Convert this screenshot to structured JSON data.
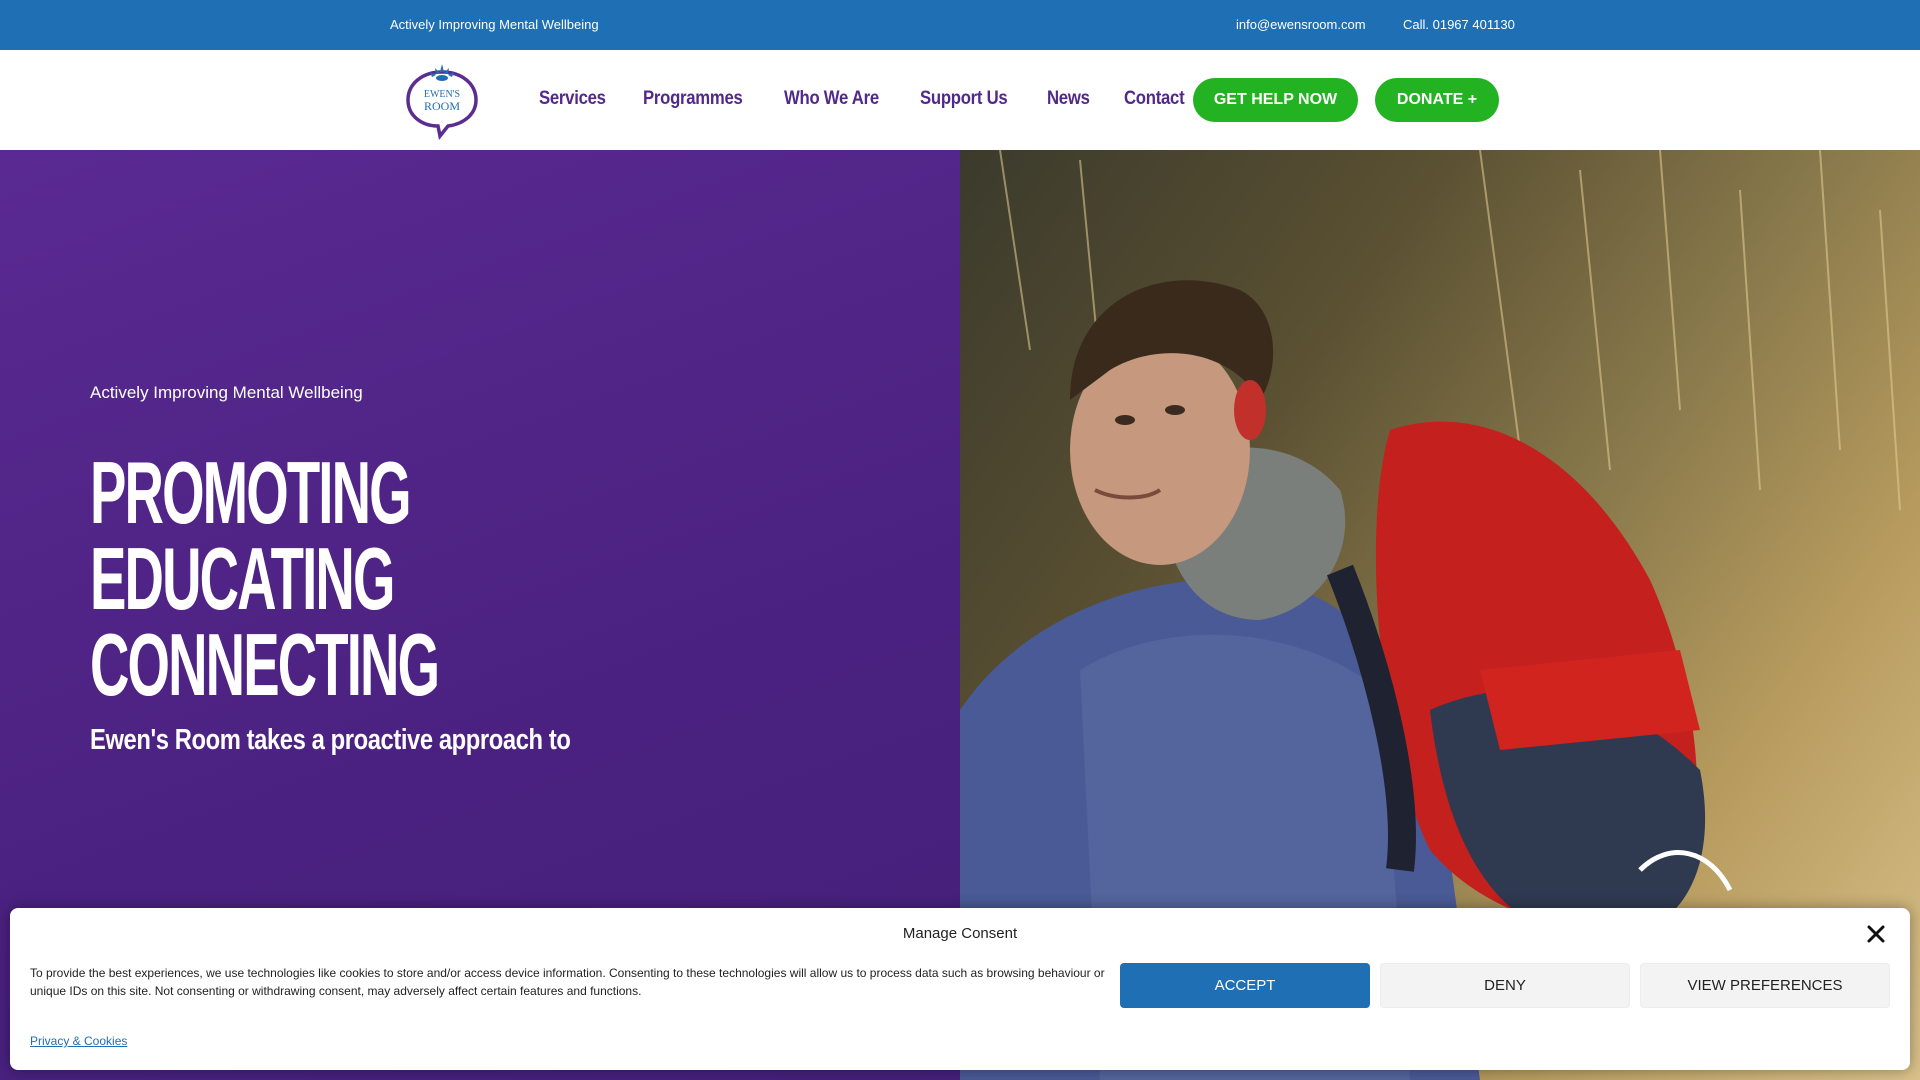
{
  "topbar": {
    "tagline": "Actively Improving Mental Wellbeing",
    "email": "info@ewensroom.com",
    "phone": "Call. 01967 401130"
  },
  "header": {
    "logo_text": [
      "EWEN'S",
      "ROOM"
    ],
    "nav": [
      "Services",
      "Programmes",
      "Who We Are",
      "Support Us",
      "News",
      "Contact"
    ],
    "get_help_label": "GET HELP NOW",
    "donate_label": "DONATE +"
  },
  "hero": {
    "subtitle": "Actively Improving Mental Wellbeing",
    "title_lines": [
      "PROMOTING",
      "EDUCATING",
      "CONNECTING"
    ],
    "lead": "Ewen's Room takes a proactive approach to"
  },
  "consent": {
    "title": "Manage Consent",
    "body": "To provide the best experiences, we use technologies like cookies to store and/or access device information. Consenting to these technologies will allow us to process data such as browsing behaviour or unique IDs on this site. Not consenting or withdrawing consent, may adversely affect certain features and functions.",
    "accept_label": "ACCEPT",
    "deny_label": "DENY",
    "preferences_label": "VIEW PREFERENCES",
    "privacy_link": "Privacy & Cookies"
  },
  "colors": {
    "brand_blue": "#1e6fb4",
    "brand_purple": "#52288c",
    "cta_green": "#22b222"
  }
}
